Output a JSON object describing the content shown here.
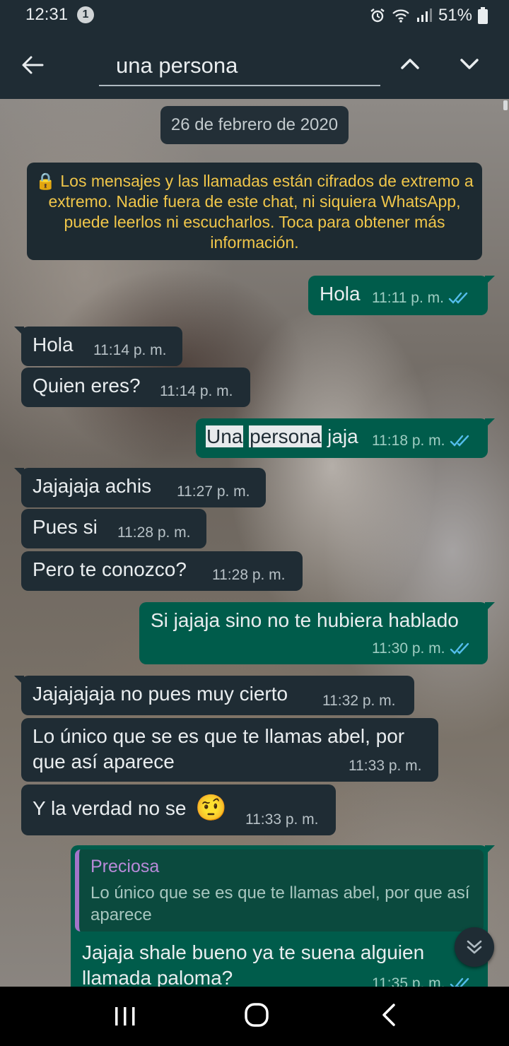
{
  "status_bar": {
    "time": "12:31",
    "notification_count": "1",
    "battery": "51%"
  },
  "search": {
    "value": "una persona"
  },
  "chat": {
    "date": "26 de febrero de 2020",
    "encryption_notice": "🔒 Los mensajes y las llamadas están cifrados de extremo a extremo. Nadie fuera de este chat, ni siquiera WhatsApp, puede leerlos ni escucharlos. Toca para obtener más información.",
    "messages": [
      {
        "direction": "out",
        "text": "Hola",
        "time": "11:11 p. m."
      },
      {
        "direction": "in",
        "text": "Hola",
        "time": "11:14 p. m."
      },
      {
        "direction": "in",
        "text": "Quien eres?",
        "time": "11:14 p. m."
      },
      {
        "direction": "out",
        "text_match1": "Una",
        "text_match2": "persona",
        "text_rest": "jaja",
        "time": "11:18 p. m."
      },
      {
        "direction": "in",
        "text": "Jajajaja achis",
        "time": "11:27 p. m."
      },
      {
        "direction": "in",
        "text": "Pues si",
        "time": "11:28 p. m."
      },
      {
        "direction": "in",
        "text": "Pero te conozco?",
        "time": "11:28 p. m."
      },
      {
        "direction": "out",
        "text": "Si jajaja sino no te hubiera hablado",
        "time": "11:30 p. m."
      },
      {
        "direction": "in",
        "text": "Jajajajaja no pues muy cierto",
        "time": "11:32 p. m."
      },
      {
        "direction": "in",
        "text_line1": "Lo único que se es que te llamas abel, por",
        "text_line2": "que así aparece",
        "time": "11:33 p. m."
      },
      {
        "direction": "in",
        "text": "Y la verdad no se",
        "emoji": "🤨",
        "time": "11:33 p. m."
      },
      {
        "direction": "out",
        "quote_name": "Preciosa",
        "quote_text": "Lo único que se es que te llamas abel, por que así aparece",
        "text_line1": "Jajaja shale bueno ya te suena alguien",
        "text_line2": "llamada paloma?",
        "time": "11:35 p. m."
      }
    ]
  },
  "colors": {
    "header": "#1f2c34",
    "incoming": "#1f2c34",
    "outgoing": "#005c4b",
    "read_ticks": "#53bdeb",
    "notice": "#f0c64a"
  },
  "icons": [
    "back-arrow-icon",
    "chevron-up-icon",
    "chevron-down-icon",
    "alarm-icon",
    "wifi-icon",
    "signal-icon",
    "battery-icon",
    "double-check-icon",
    "scroll-down-icon",
    "recent-apps-icon",
    "home-icon",
    "nav-back-icon"
  ]
}
